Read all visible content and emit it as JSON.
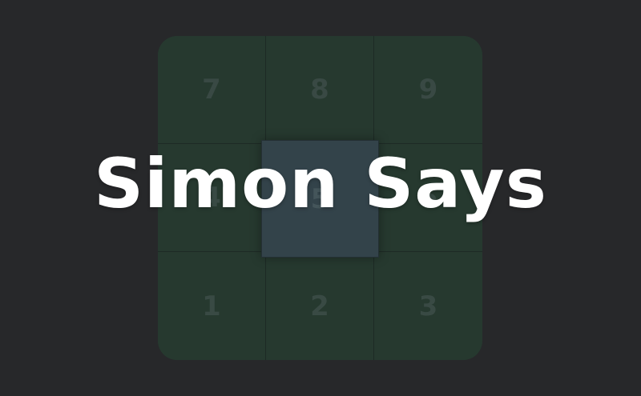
{
  "game": {
    "title": "Simon Says",
    "grid": {
      "rows": [
        [
          "7",
          "8",
          "9"
        ],
        [
          "4",
          "5",
          "6"
        ],
        [
          "1",
          "2",
          "3"
        ]
      ],
      "highlighted_cell": "5"
    },
    "colors": {
      "background": "#27282a",
      "tile": "#26392f",
      "tile_number": "#3c4c47",
      "highlight": "#33434a",
      "title": "#ffffff"
    }
  }
}
